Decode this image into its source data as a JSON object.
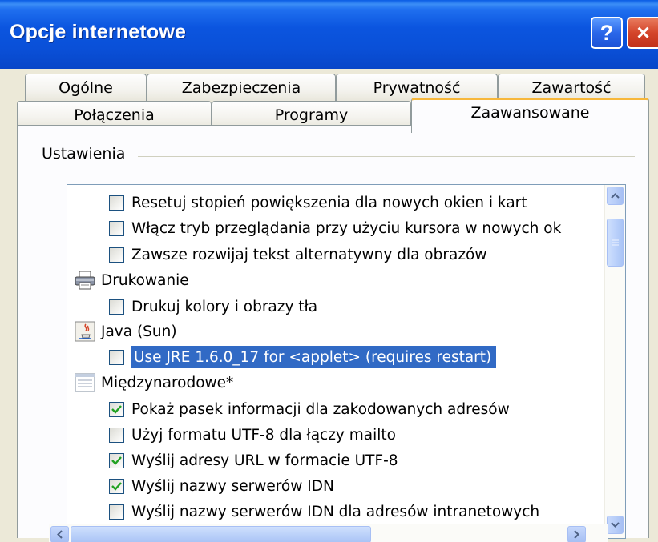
{
  "window": {
    "title": "Opcje internetowe",
    "help_label": "?",
    "close_label": "×"
  },
  "tabs": {
    "row_back": [
      "Ogólne",
      "Zabezpieczenia",
      "Prywatność",
      "Zawartość"
    ],
    "row_front": [
      "Połączenia",
      "Programy",
      "Zaawansowane"
    ],
    "active": "Zaawansowane"
  },
  "settings": {
    "group_label": "Ustawienia",
    "items": [
      {
        "type": "option",
        "label": "Resetuj stopień powiększenia dla nowych okien i kart",
        "checked": false
      },
      {
        "type": "option",
        "label": "Włącz tryb przeglądania przy użyciu kursora w nowych ok",
        "checked": false
      },
      {
        "type": "option",
        "label": "Zawsze rozwijaj tekst alternatywny dla obrazów",
        "checked": false
      },
      {
        "type": "category",
        "label": "Drukowanie",
        "icon": "printer-icon"
      },
      {
        "type": "option",
        "label": "Drukuj kolory i obrazy tła",
        "checked": false
      },
      {
        "type": "category",
        "label": "Java (Sun)",
        "icon": "java-icon"
      },
      {
        "type": "option",
        "label": "Use JRE 1.6.0_17 for <applet> (requires restart)",
        "checked": false,
        "selected": true
      },
      {
        "type": "category",
        "label": "Międzynarodowe*",
        "icon": "international-icon"
      },
      {
        "type": "option",
        "label": "Pokaż pasek informacji dla zakodowanych adresów",
        "checked": true
      },
      {
        "type": "option",
        "label": "Użyj formatu UTF-8 dla łączy mailto",
        "checked": false
      },
      {
        "type": "option",
        "label": "Wyślij adresy URL w formacie UTF-8",
        "checked": true
      },
      {
        "type": "option",
        "label": "Wyślij nazwy serwerów IDN",
        "checked": true
      },
      {
        "type": "option",
        "label": "Wyślij nazwy serwerów IDN dla adresów intranetowych",
        "checked": false
      }
    ]
  },
  "colors": {
    "titlebar": "#0a50d8",
    "selection": "#316ac5",
    "active_tab_accent": "#f7b73a"
  }
}
